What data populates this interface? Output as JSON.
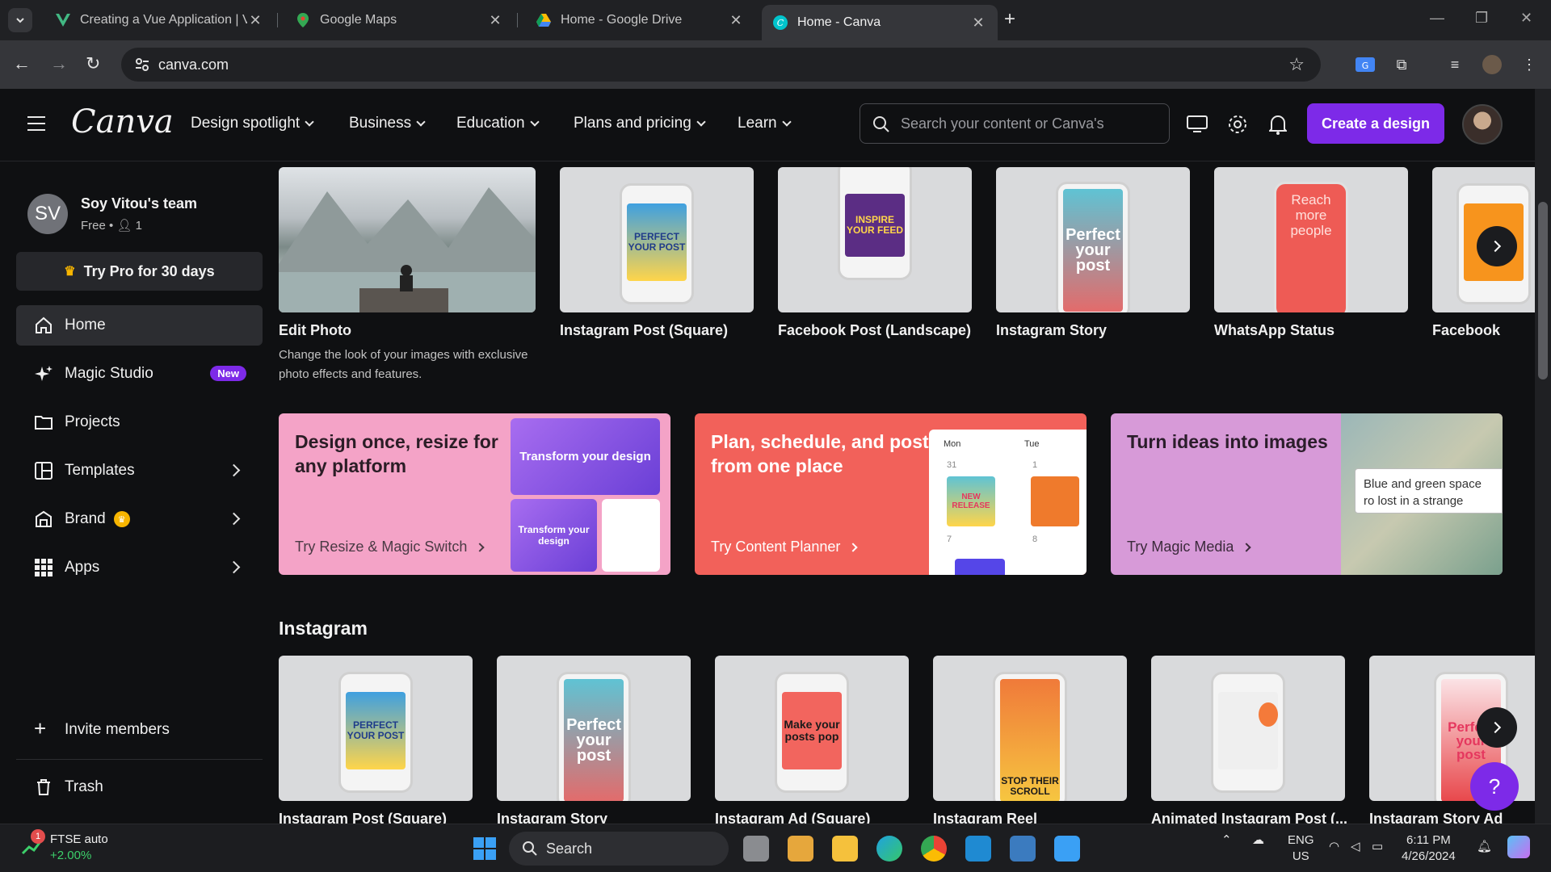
{
  "browser": {
    "tabs": [
      {
        "title": "Creating a Vue Application | Vue",
        "active": false
      },
      {
        "title": "Google Maps",
        "active": false
      },
      {
        "title": "Home - Google Drive",
        "active": false
      },
      {
        "title": "Home - Canva",
        "active": true
      }
    ],
    "url": "canva.com"
  },
  "header": {
    "logo": "Canva",
    "menu": [
      "Design spotlight",
      "Business",
      "Education",
      "Plans and pricing",
      "Learn"
    ],
    "search_placeholder": "Search your content or Canva's",
    "create_label": "Create a design"
  },
  "sidebar": {
    "team_initials": "SV",
    "team_name": "Soy Vitou's team",
    "team_plan": "Free",
    "team_members": "1",
    "try_pro": "Try Pro for 30 days",
    "items": [
      {
        "label": "Home"
      },
      {
        "label": "Magic Studio",
        "badge": "New"
      },
      {
        "label": "Projects"
      },
      {
        "label": "Templates"
      },
      {
        "label": "Brand"
      },
      {
        "label": "Apps"
      }
    ],
    "invite": "Invite members",
    "trash": "Trash"
  },
  "top_row": [
    {
      "title": "Edit Photo",
      "desc": "Change the look of your images with exclusive photo effects and features."
    },
    {
      "title": "Instagram Post (Square)",
      "thumb_text": "PERFECT YOUR POST"
    },
    {
      "title": "Facebook Post (Landscape)",
      "thumb_text": "INSPIRE YOUR FEED"
    },
    {
      "title": "Instagram Story",
      "thumb_text": "Perfect your post"
    },
    {
      "title": "WhatsApp Status",
      "thumb_text": "Reach more people"
    },
    {
      "title": "Facebook"
    }
  ],
  "promos": [
    {
      "heading": "Design once, resize for any platform",
      "link": "Try Resize & Magic Switch",
      "art_text": "Transform your design"
    },
    {
      "heading": "Plan, schedule, and post from one place",
      "link": "Try Content Planner",
      "day1": "Mon",
      "day2": "Tue",
      "d1": "31",
      "d2": "1",
      "d3": "7",
      "d4": "8",
      "art_text": "NEW RELEASE"
    },
    {
      "heading": "Turn ideas into images",
      "link": "Try Magic Media",
      "prompt": "Blue and green space ro lost in a strange planet"
    }
  ],
  "instagram": {
    "title": "Instagram",
    "cards": [
      {
        "title": "Instagram Post (Square)",
        "thumb_text": "PERFECT YOUR POST"
      },
      {
        "title": "Instagram Story",
        "thumb_text": "Perfect your post"
      },
      {
        "title": "Instagram Ad (Square)",
        "thumb_text": "Make your posts pop"
      },
      {
        "title": "Instagram Reel",
        "thumb_text": "STOP THEIR SCROLL"
      },
      {
        "title": "Animated Instagram Post (..."
      },
      {
        "title": "Instagram Story Ad",
        "thumb_text": "Perfect your post"
      }
    ]
  },
  "taskbar": {
    "ticker_name": "FTSE auto",
    "ticker_change": "+2.00%",
    "ticker_badge": "1",
    "search": "Search",
    "lang1": "ENG",
    "lang2": "US",
    "time": "6:11 PM",
    "date": "4/26/2024"
  },
  "colors": {
    "accent": "#7d2ae8",
    "promo1": "#f4a3c7",
    "promo2": "#f2615a",
    "promo3": "#d79ad8"
  }
}
